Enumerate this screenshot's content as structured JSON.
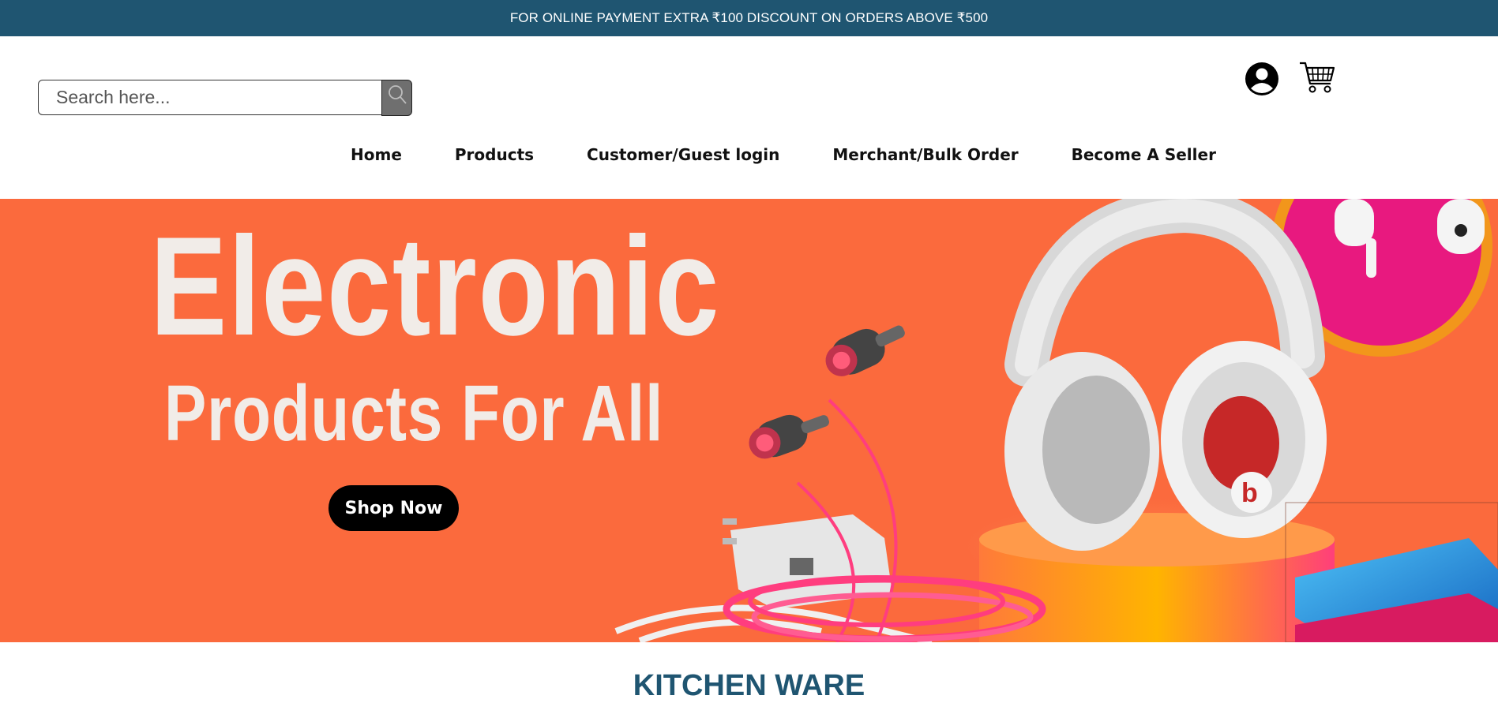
{
  "announcement": {
    "text": "FOR ONLINE PAYMENT EXTRA ₹100 DISCOUNT ON ORDERS ABOVE ₹500"
  },
  "search": {
    "placeholder": "Search here..."
  },
  "icons": {
    "search": "search-icon",
    "user": "user-account-icon",
    "cart": "shopping-cart-icon"
  },
  "nav": {
    "items": [
      {
        "label": "Home"
      },
      {
        "label": "Products"
      },
      {
        "label": "Customer/Guest login"
      },
      {
        "label": "Merchant/Bulk Order"
      },
      {
        "label": "Become A Seller"
      }
    ]
  },
  "banner": {
    "headline_line1": "Electronic",
    "headline_line2": "Products For All",
    "cta_label": "Shop Now"
  },
  "section": {
    "title": "KITCHEN WARE"
  },
  "colors": {
    "primary": "#1f5571",
    "banner_bg": "#fb6a3d",
    "accent_pink": "#e8197f"
  }
}
